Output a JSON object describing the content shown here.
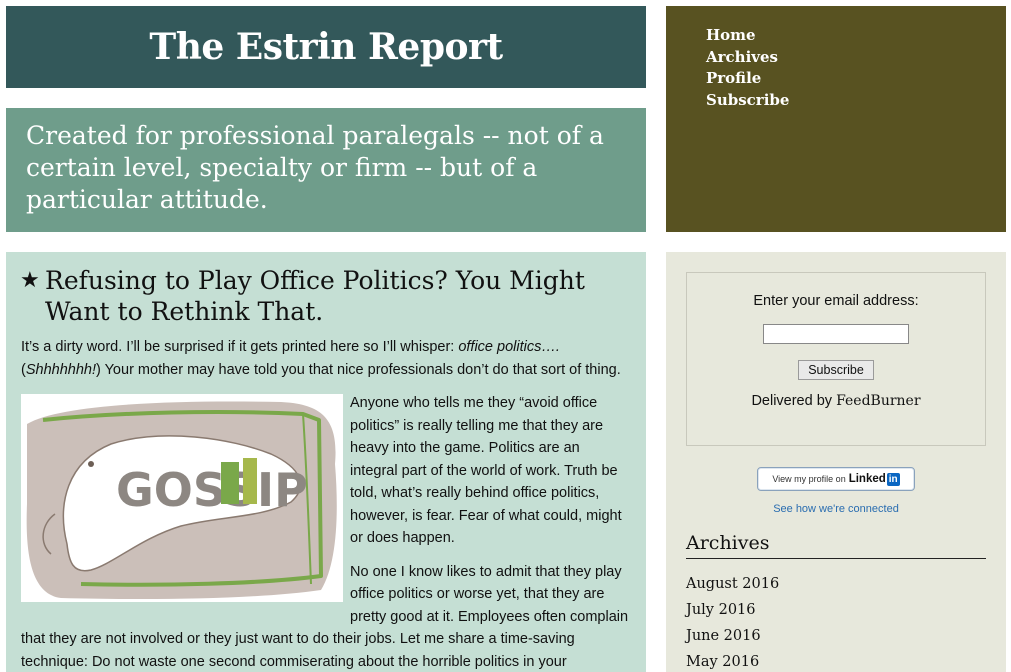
{
  "header": {
    "site_title": "The Estrin Report",
    "tagline": "Created for professional paralegals -- not of a certain level, specialty or firm -- but of a particular attitude."
  },
  "nav": {
    "items": [
      {
        "label": "Home"
      },
      {
        "label": "Archives"
      },
      {
        "label": "Profile"
      },
      {
        "label": "Subscribe"
      }
    ]
  },
  "post": {
    "icon": "star-icon",
    "title": "Refusing to Play Office Politics? You Might Want to Rethink That.",
    "p1_start": "It’s a dirty word.  I’ll be surprised if it gets printed here so I’ll whisper:  ",
    "p1_em1": "office politics….",
    "p1_open": " (",
    "p1_em2": "Shhhhhhh!",
    "p1_end": ")  Your mother may have told you that nice professionals don’t do that sort of thing.",
    "p2": "Anyone who tells me they “avoid office politics” is really telling me that they are heavy into the game.  Politics are an integral part of the world of work. Truth be told, what’s really behind office politics, however, is fear. Fear of what could, might or does happen.",
    "p3": "No one I know likes to admit that they play office politics or worse yet, that they are pretty good at it. Employees often complain that they are not involved or they just want to do their jobs.  Let me share a time-saving technique:  Do not waste one second commiserating about the horrible politics in your",
    "image_text": "GOSSIP"
  },
  "subscribe": {
    "label": "Enter your email address:",
    "input_value": "",
    "button_label": "Subscribe",
    "delivered_prefix": "Delivered by ",
    "delivered_brand": "FeedBurner"
  },
  "linkedin": {
    "view_text": "View my profile on",
    "brand": "Linked",
    "brand_in": "in",
    "caption": "See how we're connected"
  },
  "archives": {
    "title": "Archives",
    "items": [
      {
        "label": "August 2016"
      },
      {
        "label": "July 2016"
      },
      {
        "label": "June 2016"
      },
      {
        "label": "May 2016"
      }
    ]
  },
  "colors": {
    "title_bg": "#33585a",
    "tagline_bg": "#6f9d8b",
    "nav_bg": "#585221",
    "main_bg": "#c5dfd4",
    "sidebar_bg": "#e7e8dc"
  }
}
